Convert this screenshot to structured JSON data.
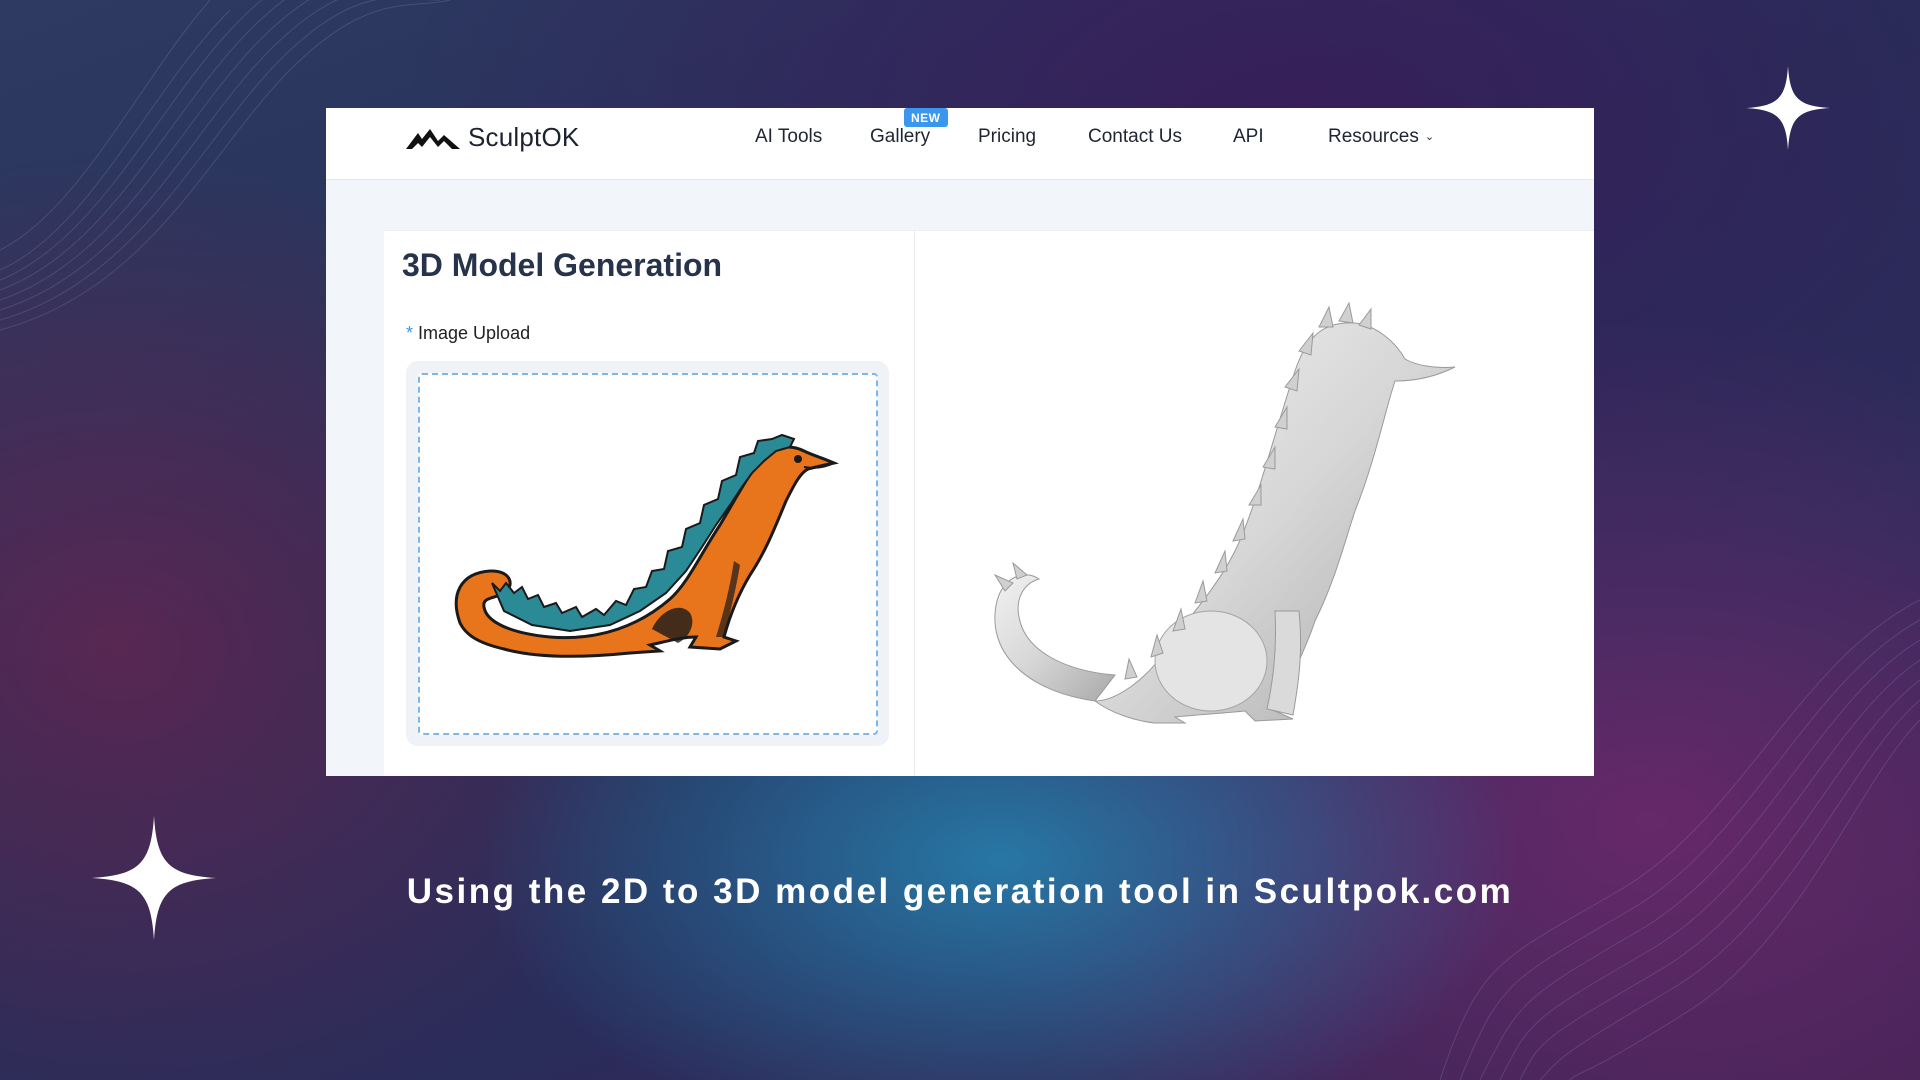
{
  "brand": {
    "name": "SculptOK",
    "logo_icon": "mountain-logo-icon"
  },
  "nav": {
    "items": [
      {
        "label": "AI Tools"
      },
      {
        "label": "Gallery",
        "badge": "NEW"
      },
      {
        "label": "Pricing"
      },
      {
        "label": "Contact Us"
      },
      {
        "label": "API"
      },
      {
        "label": "Resources",
        "icon": "chevron-down-icon"
      }
    ]
  },
  "form": {
    "title": "3D Model Generation",
    "required_marker": "*",
    "upload_label": "Image Upload"
  },
  "caption": "Using the 2D to 3D model generation tool in Scultpok.com",
  "colors": {
    "accent": "#3b97ee",
    "dragon_orange": "#e8741c",
    "dragon_teal": "#2a8a95",
    "model_gray": "#d6d6d6"
  }
}
